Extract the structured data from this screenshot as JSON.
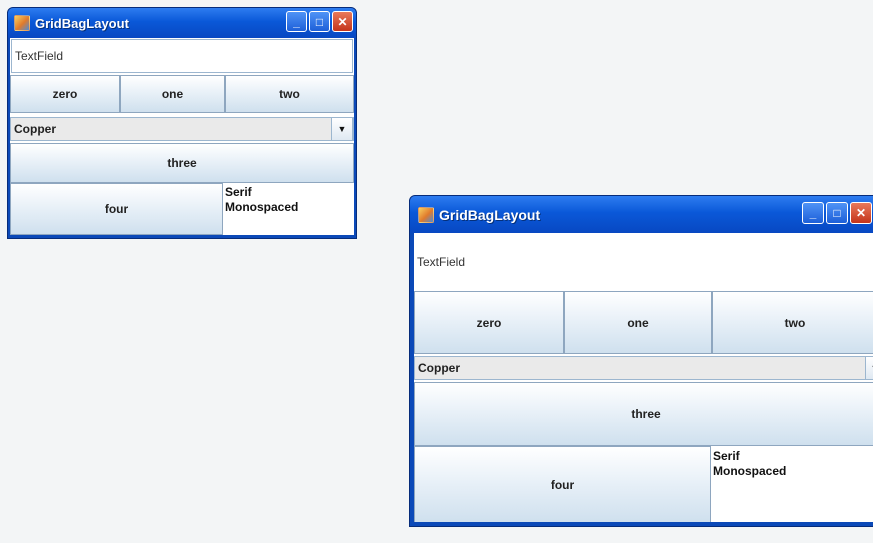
{
  "windows": [
    {
      "title": "GridBagLayout",
      "text_field": "TextField",
      "buttons": {
        "zero": "zero",
        "one": "one",
        "two": "two",
        "three": "three",
        "four": "four"
      },
      "combo_value": "Copper",
      "list_items": [
        "Serif",
        "Monospaced"
      ]
    },
    {
      "title": "GridBagLayout",
      "text_field": "TextField",
      "buttons": {
        "zero": "zero",
        "one": "one",
        "two": "two",
        "three": "three",
        "four": "four"
      },
      "combo_value": "Copper",
      "list_items": [
        "Serif",
        "Monospaced"
      ]
    }
  ],
  "titlebar_buttons": {
    "minimize": "_",
    "maximize": "□",
    "close": "✕"
  },
  "combo_arrow": "▼",
  "colors": {
    "title_bar": "#0a58d8",
    "window_border": "#0b49b8",
    "close_button": "#c4341a",
    "button_gradient_bottom": "#cfe0ee"
  }
}
